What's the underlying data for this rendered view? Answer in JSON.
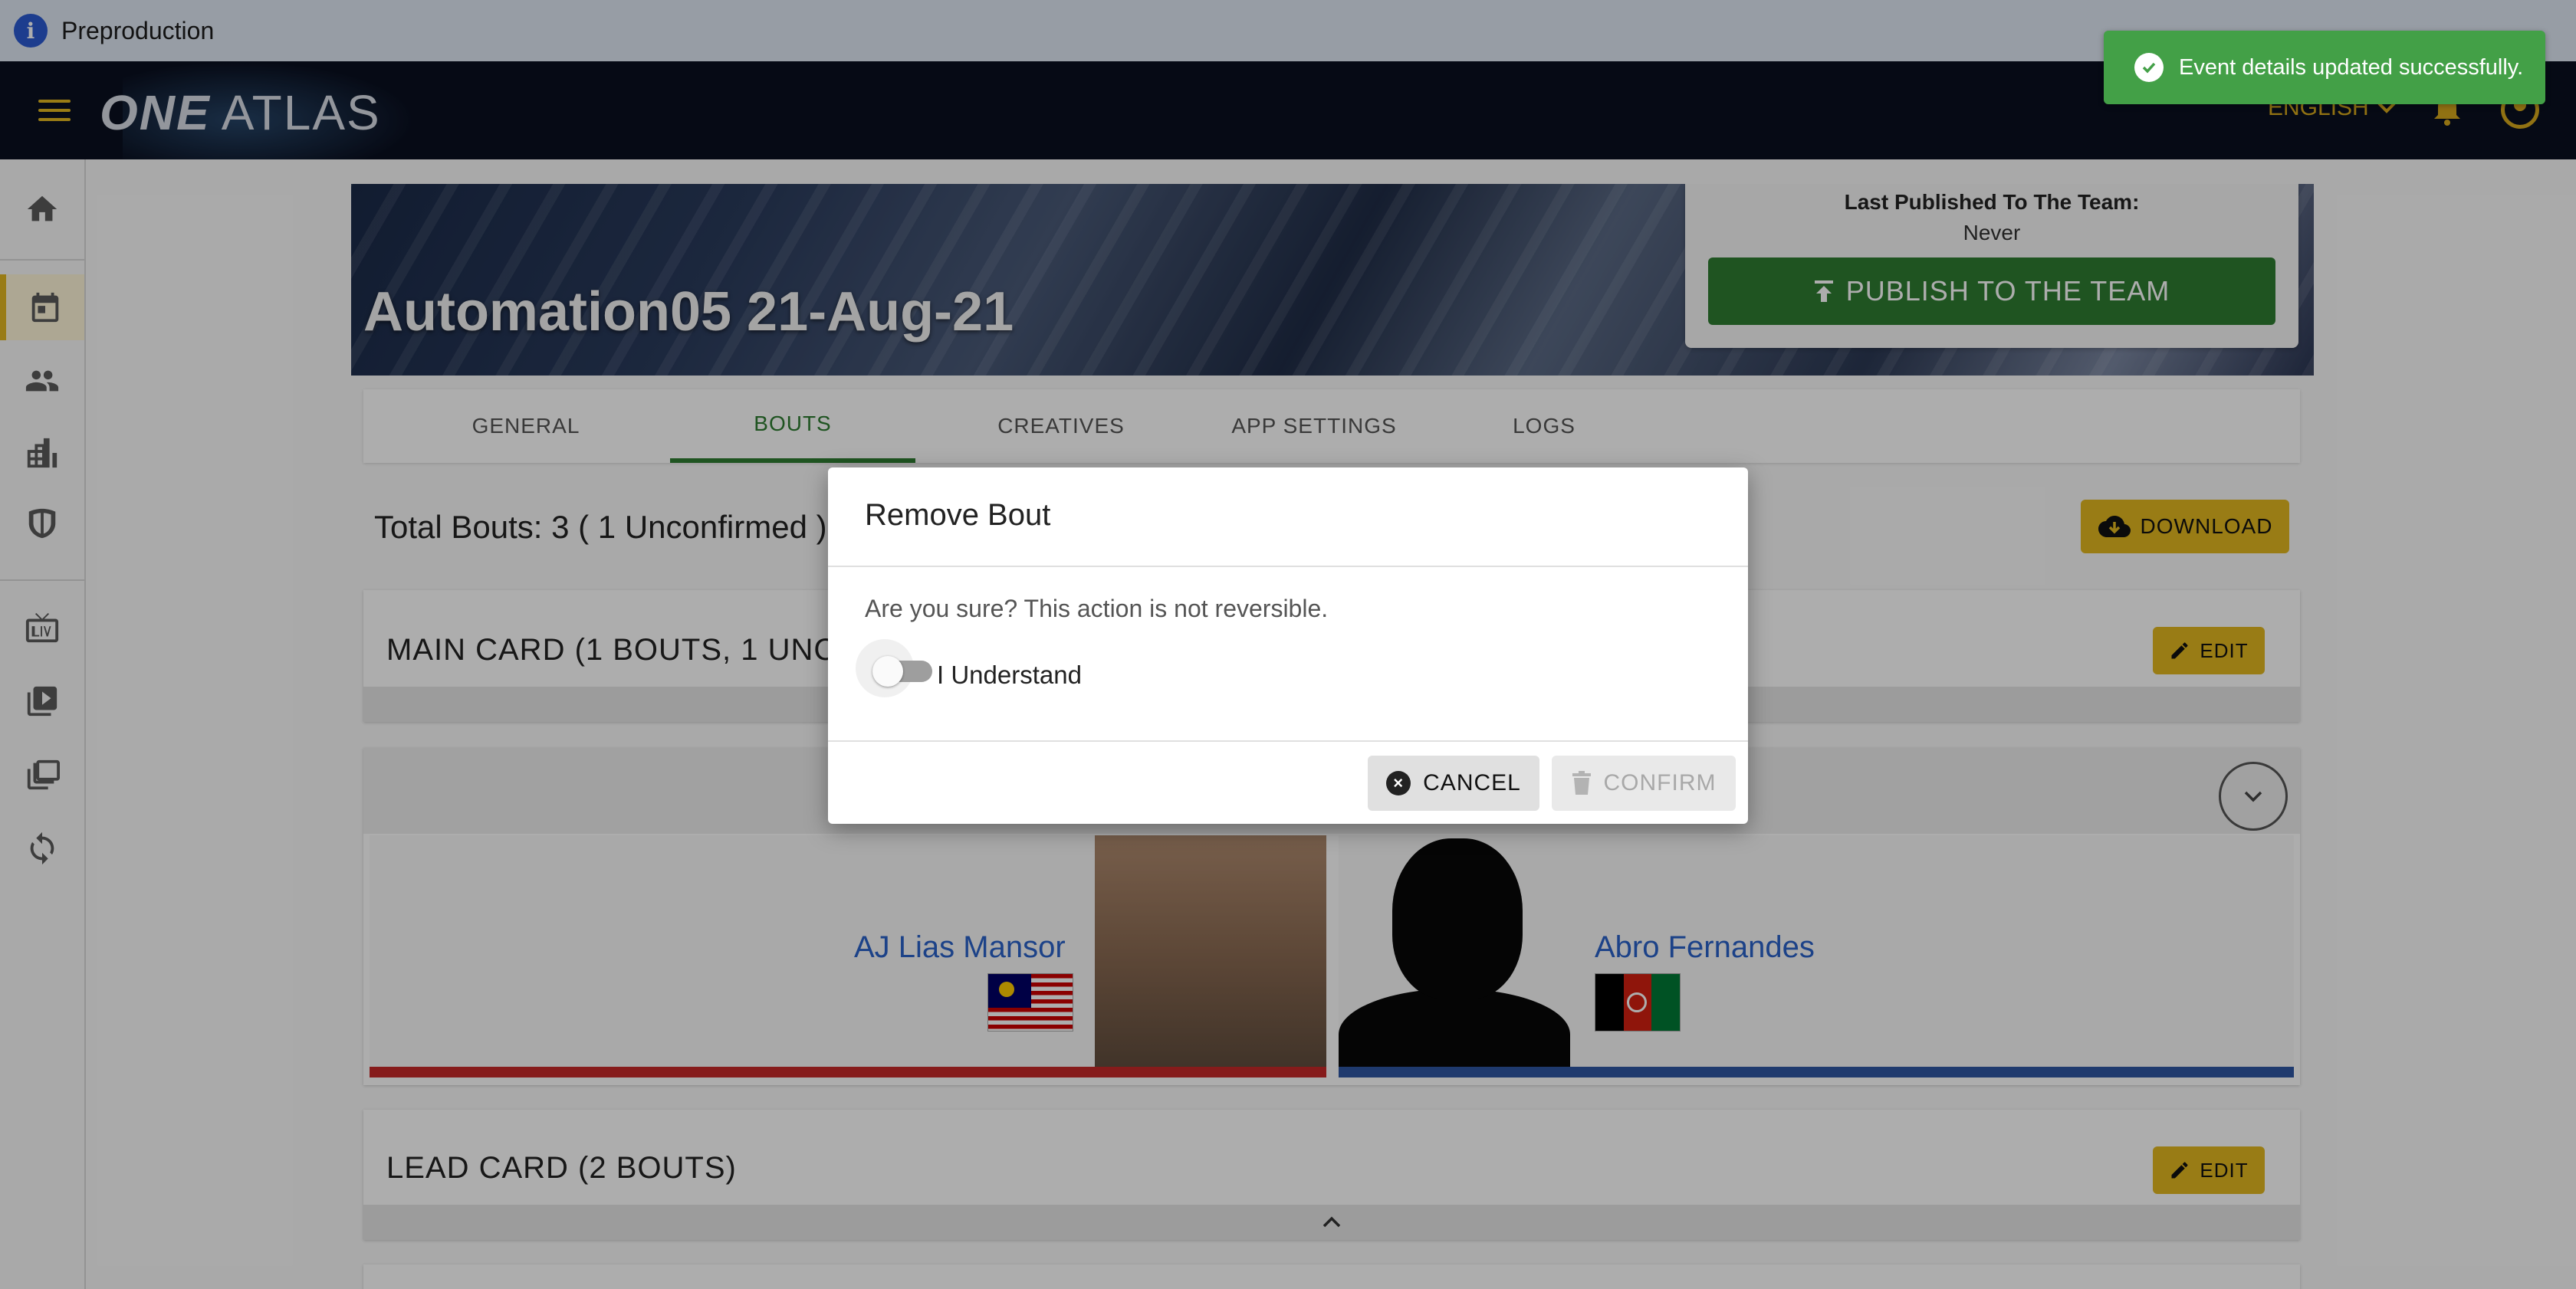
{
  "env": {
    "label": "Preproduction",
    "icon": "info-icon"
  },
  "topbar": {
    "logo_bold": "ONE",
    "logo_light": "ATLAS",
    "language": "ENGLISH",
    "icons": [
      "menu-icon",
      "bell-icon",
      "account-icon",
      "chevron-down-icon"
    ],
    "accent_color": "#e2b720"
  },
  "sidebar": {
    "items": [
      {
        "name": "home",
        "icon": "home-icon"
      },
      {
        "name": "events",
        "icon": "calendar-icon",
        "active": true
      },
      {
        "name": "athletes",
        "icon": "people-icon"
      },
      {
        "name": "venues",
        "icon": "building-icon"
      },
      {
        "name": "teams",
        "icon": "shield-icon"
      },
      {
        "name": "live",
        "icon": "live-tv-icon"
      },
      {
        "name": "videos",
        "icon": "video-library-icon"
      },
      {
        "name": "galleries",
        "icon": "collections-icon"
      },
      {
        "name": "sync",
        "icon": "sync-icon"
      }
    ]
  },
  "event": {
    "title": "Automation05 21-Aug-21",
    "last_published_label": "Last Published To The Team:",
    "last_published_value": "Never",
    "publish_button": "PUBLISH TO THE TEAM"
  },
  "tabs": [
    {
      "label": "GENERAL",
      "active": false
    },
    {
      "label": "BOUTS",
      "active": true
    },
    {
      "label": "CREATIVES",
      "active": false
    },
    {
      "label": "APP SETTINGS",
      "active": false
    },
    {
      "label": "LOGS",
      "active": false
    }
  ],
  "bouts_summary": {
    "total_text": "Total Bouts: 3 ( 1 Unconfirmed )",
    "download_button": "DOWNLOAD"
  },
  "cards": [
    {
      "title": "MAIN CARD (1 BOUTS, 1 UNCONFIRMED)",
      "edit_button": "EDIT"
    },
    {
      "title": "LEAD CARD (2 BOUTS)",
      "edit_button": "EDIT"
    }
  ],
  "bout": {
    "red_corner": {
      "name": "AJ Lias Mansor",
      "flag": "Malaysia"
    },
    "blue_corner": {
      "name": "Abro Fernandes",
      "flag": "Afghanistan"
    }
  },
  "toast": {
    "message": "Event details updated successfully.",
    "color": "#43a047"
  },
  "dialog": {
    "title": "Remove Bout",
    "message": "Are you sure? This action is not reversible.",
    "toggle_label": "I Understand",
    "toggle_on": false,
    "cancel_button": "CANCEL",
    "confirm_button": "CONFIRM",
    "confirm_disabled": true
  }
}
